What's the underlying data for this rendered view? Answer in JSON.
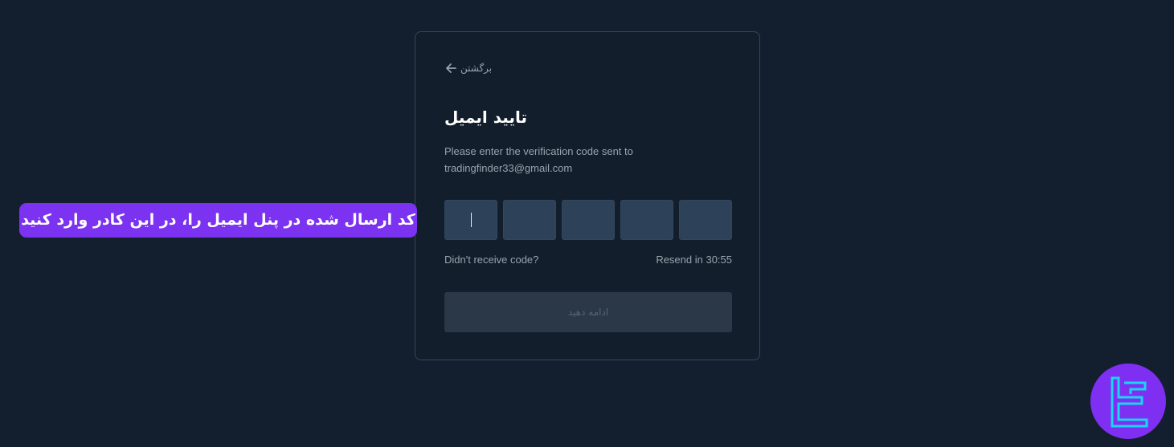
{
  "card": {
    "back_label": "برگشتن",
    "back_icon": "arrow-left-icon",
    "title": "تایید ایمیل",
    "description_line1": "Please enter the verification code sent to",
    "description_line2": "tradingfinder33@gmail.com",
    "code_boxes": [
      "",
      "",
      "",
      "",
      ""
    ],
    "didnt_receive": "Didn't receive code?",
    "resend": "Resend in 30:55",
    "continue_label": "ادامه دهید"
  },
  "annotation": {
    "text": "کد ارسال شده در پنل ایمیل را، در این کادر وارد کنید",
    "color": "#7b32f1"
  },
  "logo": {
    "icon": "tradingfinder-logo-icon",
    "color": "#7f2ff2"
  },
  "colors": {
    "background": "#131f2e",
    "input": "#2d4158",
    "button_disabled": "#2a3847"
  }
}
